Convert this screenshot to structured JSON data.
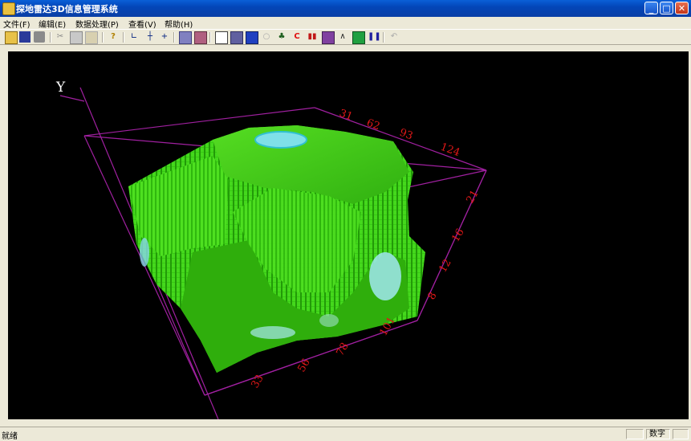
{
  "window": {
    "title": "探地雷达3D信息管理系统"
  },
  "menu": {
    "items": [
      "文件(F)",
      "编辑(E)",
      "数据处理(P)",
      "查看(V)",
      "帮助(H)"
    ]
  },
  "toolbar": {
    "icons": [
      "open-icon",
      "save-icon",
      "print-icon",
      "cut-icon",
      "copy-icon",
      "paste-icon",
      "help-pointer-icon",
      "axis-icon",
      "grid-icon",
      "crosshair-icon",
      "layers-icon",
      "image-icon",
      "slice-icon",
      "cube-icon",
      "stack-icon",
      "circle-icon",
      "cluster-icon",
      "c-icon",
      "bars-icon",
      "volume-icon",
      "peak-icon",
      "fill-icon",
      "pause-icon",
      "undo-icon"
    ],
    "c_label": "C"
  },
  "viewport": {
    "axis_label_y": "Y",
    "top_ticks": [
      "31",
      "62",
      "93",
      "124"
    ],
    "right_ticks": [
      "21",
      "16",
      "12",
      "8"
    ],
    "bottom_ticks": [
      "101",
      "78",
      "56",
      "33"
    ],
    "axis_color": "#a020a0",
    "tick_color": "#e01818",
    "volume_color": "#33cc11"
  },
  "status": {
    "ready": "就绪",
    "num": "数字"
  }
}
